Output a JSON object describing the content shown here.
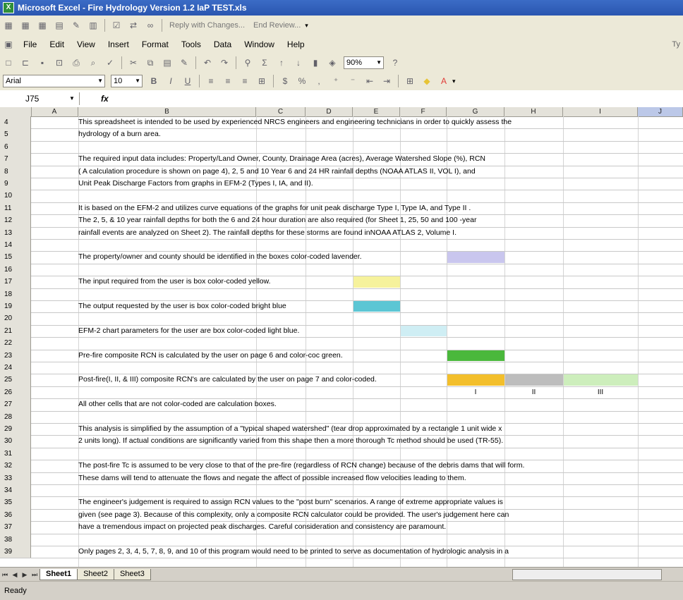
{
  "window": {
    "title": "Microsoft Excel - Fire Hydrology Version 1.2 IaP TEST.xls"
  },
  "review_toolbar": {
    "reply_label": "Reply with Changes...",
    "end_review_label": "End Review..."
  },
  "menu": {
    "items": [
      "File",
      "Edit",
      "View",
      "Insert",
      "Format",
      "Tools",
      "Data",
      "Window",
      "Help"
    ],
    "question_box": "Ty"
  },
  "standard_toolbar": {
    "zoom": "90%"
  },
  "format_toolbar": {
    "font": "Arial",
    "size": "10"
  },
  "formula_bar": {
    "name_box": "J75",
    "fx": "fx",
    "content": ""
  },
  "columns": [
    "A",
    "B",
    "C",
    "D",
    "E",
    "F",
    "G",
    "H",
    "I",
    "J"
  ],
  "rows": [
    {
      "n": "4",
      "text": "This spreadsheet is intended to be used by experienced NRCS engineers and engineering technicians in order to quickly assess the"
    },
    {
      "n": "5",
      "text": "hydrology of a burn area."
    },
    {
      "n": "6",
      "text": ""
    },
    {
      "n": "7",
      "text": "The required input data includes: Property/Land Owner, County, Drainage Area (acres), Average Watershed Slope (%), RCN"
    },
    {
      "n": "8",
      "text": "( A calculation procedure is shown on page 4), 2, 5 and 10 Year  6 and 24 HR rainfall depths (NOAA ATLAS II, VOL I), and"
    },
    {
      "n": "9",
      "text": "Unit Peak Discharge Factors from graphs in EFM-2 (Types I, IA, and II)."
    },
    {
      "n": "10",
      "text": ""
    },
    {
      "n": "11",
      "text": "It is based on the EFM-2 and utilizes curve equations of the graphs for unit peak discharge Type I, Type IA, and Type II ."
    },
    {
      "n": "12",
      "text": "The 2, 5, & 10 year rainfall depths for both the 6 and 24 hour duration are also required (for Sheet 1, 25, 50 and 100 -year"
    },
    {
      "n": "13",
      "text": "rainfall events are analyzed on Sheet 2).  The rainfall depths for these storms are found inNOAA ATLAS 2, Volume I."
    },
    {
      "n": "14",
      "text": ""
    },
    {
      "n": "15",
      "text": "The property/owner and county should be identified in the boxes color-coded lavender."
    },
    {
      "n": "16",
      "text": ""
    },
    {
      "n": "17",
      "text": "The input required from the user is box color-coded yellow."
    },
    {
      "n": "18",
      "text": ""
    },
    {
      "n": "19",
      "text": "The output requested by the user is box color-coded bright blue"
    },
    {
      "n": "20",
      "text": ""
    },
    {
      "n": "21",
      "text": "EFM-2 chart parameters for the user are box color-coded light blue."
    },
    {
      "n": "22",
      "text": ""
    },
    {
      "n": "23",
      "text": "Pre-fire composite RCN is calculated by the user on page 6 and color-coc green."
    },
    {
      "n": "24",
      "text": ""
    },
    {
      "n": "25",
      "text": "Post-fire(I, II, & III) composite RCN's are calculated by the user on page 7 and color-coded."
    },
    {
      "n": "26",
      "text": ""
    },
    {
      "n": "27",
      "text": "All other cells that are not color-coded are calculation boxes."
    },
    {
      "n": "28",
      "text": ""
    },
    {
      "n": "29",
      "text": "This analysis is simplified by the assumption of a \"typical shaped watershed\" (tear drop approximated by a rectangle 1 unit wide x"
    },
    {
      "n": "30",
      "text": "2 units long).  If actual conditions are significantly varied from this shape then a more thorough Tc method should be used (TR-55)."
    },
    {
      "n": "31",
      "text": ""
    },
    {
      "n": "32",
      "text": "The post-fire Tc is assumed to be very close to that of the pre-fire (regardless of RCN change) because of the debris dams that will form."
    },
    {
      "n": "33",
      "text": "These dams will tend to attenuate the flows and negate the affect of possible increased flow velocities leading to them."
    },
    {
      "n": "34",
      "text": ""
    },
    {
      "n": "35",
      "text": "The engineer's judgement is required to assign RCN values to the \"post burn\" scenarios.  A range of extreme appropriate values is"
    },
    {
      "n": "36",
      "text": "given (see page 3).  Because of this complexity, only a composite RCN calculator could be provided.  The user's judgement here can"
    },
    {
      "n": "37",
      "text": "have a tremendous impact on projected peak discharges.  Careful consideration and consistency are paramount."
    },
    {
      "n": "38",
      "text": ""
    },
    {
      "n": "39",
      "text": "Only pages 2, 3, 4, 5, 7, 8, 9, and 10 of this program would need to be printed to serve as documentation of hydrologic analysis in a"
    }
  ],
  "post_fire_labels": [
    "I",
    "II",
    "III"
  ],
  "swatch_colors": {
    "lavender": "#c9c6ee",
    "yellow": "#f6f29c",
    "bright_blue": "#5cc6d4",
    "light_blue": "#cfeef4",
    "green": "#4ab83c",
    "orange": "#f3bf2c",
    "gray": "#bdbdbd",
    "light_green": "#cdeebc"
  },
  "sheet_tabs": [
    "Sheet1",
    "Sheet2",
    "Sheet3"
  ],
  "status": "Ready"
}
